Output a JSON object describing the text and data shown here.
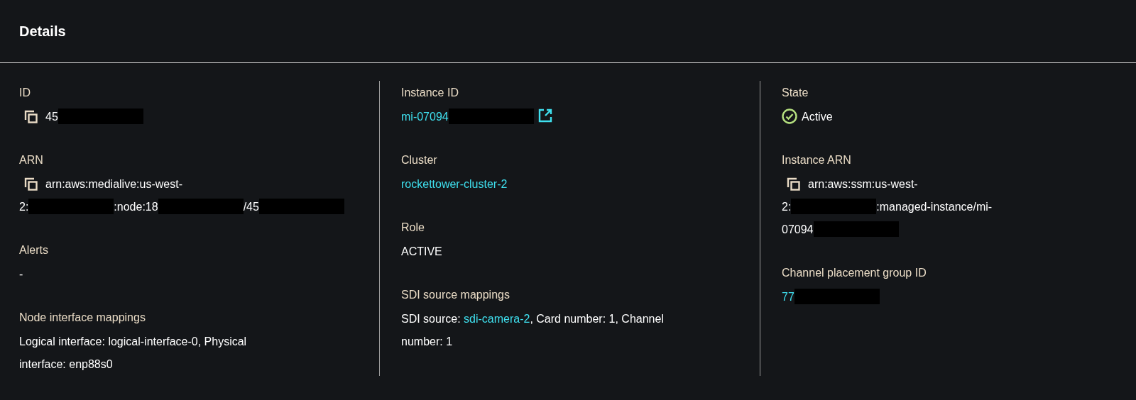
{
  "panel": {
    "title": "Details"
  },
  "columns": [
    {
      "fields": [
        {
          "label": "ID",
          "copy": true,
          "lines": [
            [
              {
                "kind": "text",
                "text": "45"
              },
              {
                "kind": "redacted"
              }
            ]
          ]
        },
        {
          "label": "ARN",
          "copy": true,
          "lines": [
            [
              {
                "kind": "text",
                "text": "arn:aws:medialive:us-west-"
              }
            ],
            [
              {
                "kind": "text",
                "text": "2:"
              },
              {
                "kind": "redacted"
              },
              {
                "kind": "text",
                "text": ":node:18"
              },
              {
                "kind": "redacted"
              },
              {
                "kind": "text",
                "text": "/45"
              },
              {
                "kind": "redacted"
              }
            ]
          ]
        },
        {
          "label": "Alerts",
          "copy": false,
          "lines": [
            [
              {
                "kind": "text",
                "text": "-"
              }
            ]
          ]
        },
        {
          "label": "Node interface mappings",
          "copy": false,
          "lines": [
            [
              {
                "kind": "text",
                "text": "Logical interface: logical-interface-0, Physical"
              }
            ],
            [
              {
                "kind": "text",
                "text": "interface: enp88s0"
              }
            ]
          ]
        }
      ]
    },
    {
      "fields": [
        {
          "label": "Instance ID",
          "copy": false,
          "lines": [
            [
              {
                "kind": "external-link",
                "text": "mi-07094"
              }
            ]
          ]
        },
        {
          "label": "Cluster",
          "copy": false,
          "lines": [
            [
              {
                "kind": "link",
                "text": "rockettower-cluster-2"
              }
            ]
          ]
        },
        {
          "label": "Role",
          "copy": false,
          "lines": [
            [
              {
                "kind": "text",
                "text": "ACTIVE"
              }
            ]
          ]
        },
        {
          "label": "SDI source mappings",
          "copy": false,
          "lines": [
            [
              {
                "kind": "text",
                "text": "SDI source: "
              },
              {
                "kind": "link",
                "text": "sdi-camera-2"
              },
              {
                "kind": "text",
                "text": ", Card number: 1, Channel"
              }
            ],
            [
              {
                "kind": "text",
                "text": "number: 1"
              }
            ]
          ]
        }
      ]
    },
    {
      "fields": [
        {
          "label": "State",
          "copy": false,
          "lines": [
            [
              {
                "kind": "status",
                "text": "Active"
              }
            ]
          ]
        },
        {
          "label": "Instance ARN",
          "copy": true,
          "lines": [
            [
              {
                "kind": "text",
                "text": "arn:aws:ssm:us-west-"
              }
            ],
            [
              {
                "kind": "text",
                "text": "2:"
              },
              {
                "kind": "redacted"
              },
              {
                "kind": "text",
                "text": ":managed-instance/mi-"
              }
            ],
            [
              {
                "kind": "text",
                "text": "07094"
              },
              {
                "kind": "redacted"
              }
            ]
          ]
        },
        {
          "label": "Channel placement group ID",
          "copy": false,
          "lines": [
            [
              {
                "kind": "link",
                "text": "77"
              },
              {
                "kind": "redacted"
              }
            ]
          ]
        }
      ]
    }
  ]
}
